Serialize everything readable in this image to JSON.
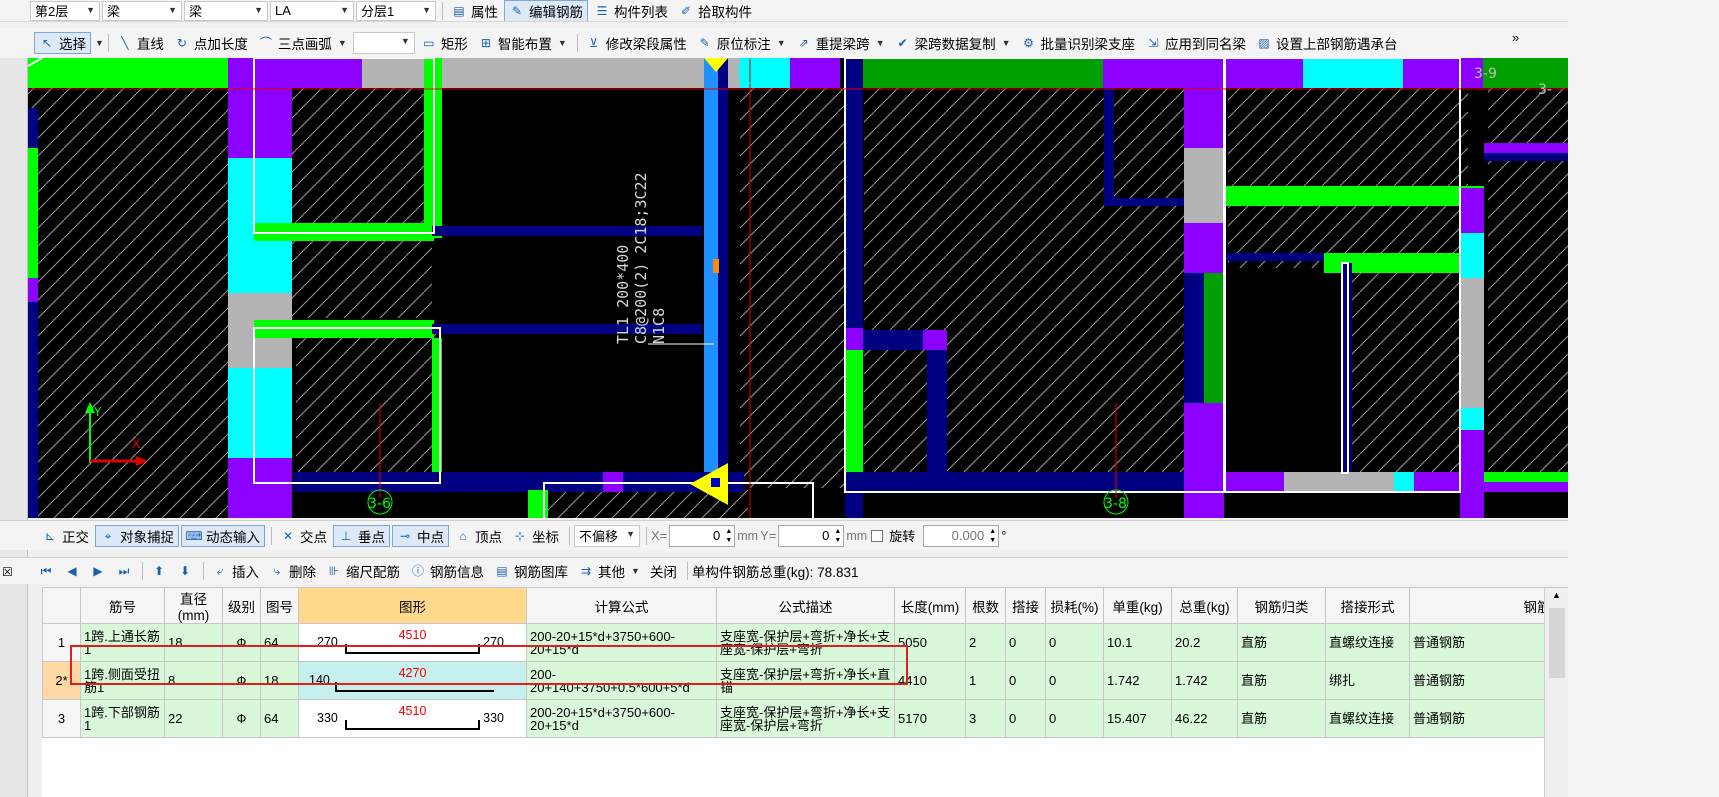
{
  "toolbar1": {
    "floor": "第2层",
    "type1": "梁",
    "type2": "梁",
    "name": "LA",
    "layer": "分层1",
    "btn_props": "属性",
    "btn_edit_rebar": "编辑钢筋",
    "btn_component_list": "构件列表",
    "btn_pick": "拾取构件"
  },
  "toolbar2": {
    "select": "选择",
    "line": "直线",
    "point_len": "点加长度",
    "arc": "三点画弧",
    "rect": "矩形",
    "smart": "智能布置",
    "modify_span": "修改梁段属性",
    "in_situ": "原位标注",
    "relift": "重提梁跨",
    "span_copy": "梁跨数据复制",
    "batch_support": "批量识别梁支座",
    "apply_same": "应用到同名梁",
    "set_top_rebar": "设置上部钢筋遇承台",
    "more": "»"
  },
  "canvas": {
    "beam_label_1": "TL1 200*400",
    "beam_label_2": "C8@200(2) 2C18;3C22",
    "beam_label_3": "N1C8",
    "axis_36": "3-6",
    "axis_38": "3-8",
    "axis_39": "3-9",
    "axis_3": "3-",
    "axis_x": "X",
    "axis_y": "Y",
    "colors": {
      "green": "#00ff00",
      "cyan": "#00ffff",
      "purple": "#8b00ff",
      "blue": "#0000a0",
      "gray": "#b4b4b4",
      "yellow": "#ffff00",
      "red": "#e00000",
      "lightblue": "#1e90ff"
    }
  },
  "snapbar": {
    "ortho": "正交",
    "snap": "对象捕捉",
    "dynamic": "动态输入",
    "intersect": "交点",
    "perp": "垂点",
    "mid": "中点",
    "vertex": "顶点",
    "coord": "坐标",
    "offset": "不偏移",
    "x_label": "X=",
    "x_value": "0",
    "unit1": "mm",
    "y_label": "Y=",
    "y_value": "0",
    "unit2": "mm",
    "rotate": "旋转",
    "rotate_value": "0.000",
    "degree": "°"
  },
  "rebarbar": {
    "insert": "插入",
    "delete": "删除",
    "scale": "缩尺配筋",
    "info": "钢筋信息",
    "library": "钢筋图库",
    "other": "其他",
    "close": "关闭",
    "total_weight": "单构件钢筋总重(kg): 78.831"
  },
  "table": {
    "headers": [
      "筋号",
      "直径(mm)",
      "级别",
      "图号",
      "图形",
      "计算公式",
      "公式描述",
      "长度(mm)",
      "根数",
      "搭接",
      "损耗(%)",
      "单重(kg)",
      "总重(kg)",
      "钢筋归类",
      "搭接形式",
      "钢筋类型"
    ],
    "rows": [
      {
        "idx": "1",
        "name": "1跨.上通长筋1",
        "dia": "18",
        "grade": "Ф",
        "fig": "64",
        "left": "270",
        "mid": "4510",
        "right": "270",
        "formula": "200-20+15*d+3750+600-20+15*d",
        "desc": "支座宽-保护层+弯折+净长+支座宽-保护层+弯折",
        "len": "5050",
        "count": "2",
        "lap": "0",
        "loss": "0",
        "unit_w": "10.1",
        "total_w": "20.2",
        "cat": "直筋",
        "lap_type": "直螺纹连接",
        "rebar_type": "普通钢筋"
      },
      {
        "idx": "2*",
        "name": "1跨.侧面受扭筋1",
        "dia": "8",
        "grade": "Ф",
        "fig": "18",
        "left": "140",
        "mid": "4270",
        "right": "",
        "formula": "200-20+140+3750+0.5*600+5*d",
        "desc": "支座宽-保护层+弯折+净长+直锚",
        "len": "4410",
        "count": "1",
        "lap": "0",
        "loss": "0",
        "unit_w": "1.742",
        "total_w": "1.742",
        "cat": "直筋",
        "lap_type": "绑扎",
        "rebar_type": "普通钢筋"
      },
      {
        "idx": "3",
        "name": "1跨.下部钢筋1",
        "dia": "22",
        "grade": "Ф",
        "fig": "64",
        "left": "330",
        "mid": "4510",
        "right": "330",
        "formula": "200-20+15*d+3750+600-20+15*d",
        "desc": "支座宽-保护层+弯折+净长+支座宽-保护层+弯折",
        "len": "5170",
        "count": "3",
        "lap": "0",
        "loss": "0",
        "unit_w": "15.407",
        "total_w": "46.22",
        "cat": "直筋",
        "lap_type": "直螺纹连接",
        "rebar_type": "普通钢筋"
      }
    ]
  }
}
